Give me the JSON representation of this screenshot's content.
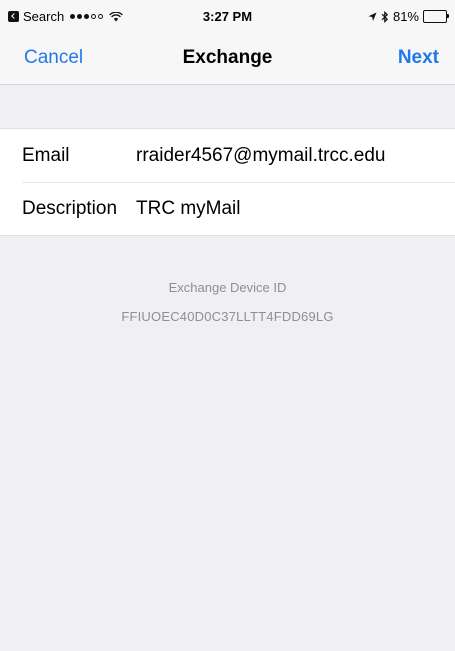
{
  "status_bar": {
    "back_app_label": "Search",
    "time": "3:27 PM",
    "battery_percent": "81%",
    "battery_level": 0.81,
    "icons": [
      "back-to-app-icon",
      "signal-dots-icon",
      "wifi-icon",
      "location-arrow-icon",
      "bluetooth-icon",
      "battery-icon"
    ]
  },
  "nav": {
    "cancel_label": "Cancel",
    "title": "Exchange",
    "next_label": "Next"
  },
  "form": {
    "email_label": "Email",
    "email_value": "rraider4567@mymail.trcc.edu",
    "description_label": "Description",
    "description_value": "TRC myMail"
  },
  "device": {
    "label": "Exchange Device ID",
    "id": "FFIUOEC40D0C37LLTT4FDD69LG"
  },
  "colors": {
    "accent": "#1f7ae8",
    "background": "#efeff4",
    "secondary_text": "#8e8e93"
  }
}
